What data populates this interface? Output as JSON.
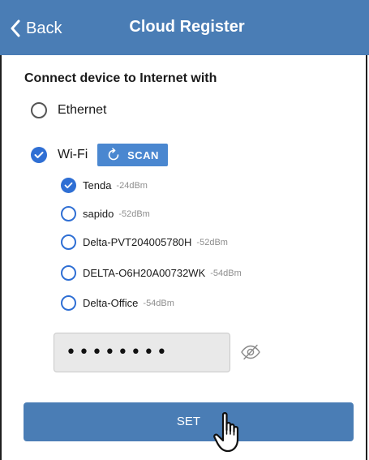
{
  "navbar": {
    "back_label": "Back",
    "title": "Cloud Register"
  },
  "heading": "Connect device to Internet with",
  "connection_options": [
    {
      "label": "Ethernet",
      "selected": false
    },
    {
      "label": "Wi-Fi",
      "selected": true
    }
  ],
  "scan_button": {
    "label": "SCAN"
  },
  "networks": [
    {
      "ssid": "Tenda",
      "signal": "-24dBm",
      "selected": true
    },
    {
      "ssid": "sapido",
      "signal": "-52dBm",
      "selected": false
    },
    {
      "ssid": "Delta-PVT204005780H",
      "signal": "-52dBm",
      "selected": false
    },
    {
      "ssid": "DELTA-O6H20A00732WK",
      "signal": "-54dBm",
      "selected": false
    },
    {
      "ssid": "Delta-Office",
      "signal": "-54dBm",
      "selected": false
    }
  ],
  "password": {
    "masked_value": "••••••••"
  },
  "set_button": {
    "label": "SET"
  },
  "colors": {
    "navbar": "#4a7db5",
    "accent": "#2f6fd4",
    "scan_button": "#4a87d0",
    "set_button": "#4a7db5"
  },
  "icons": {
    "back": "chevron-left-icon",
    "scan": "refresh-icon",
    "visibility": "eye-off-icon",
    "pointer": "hand-pointer-icon"
  }
}
